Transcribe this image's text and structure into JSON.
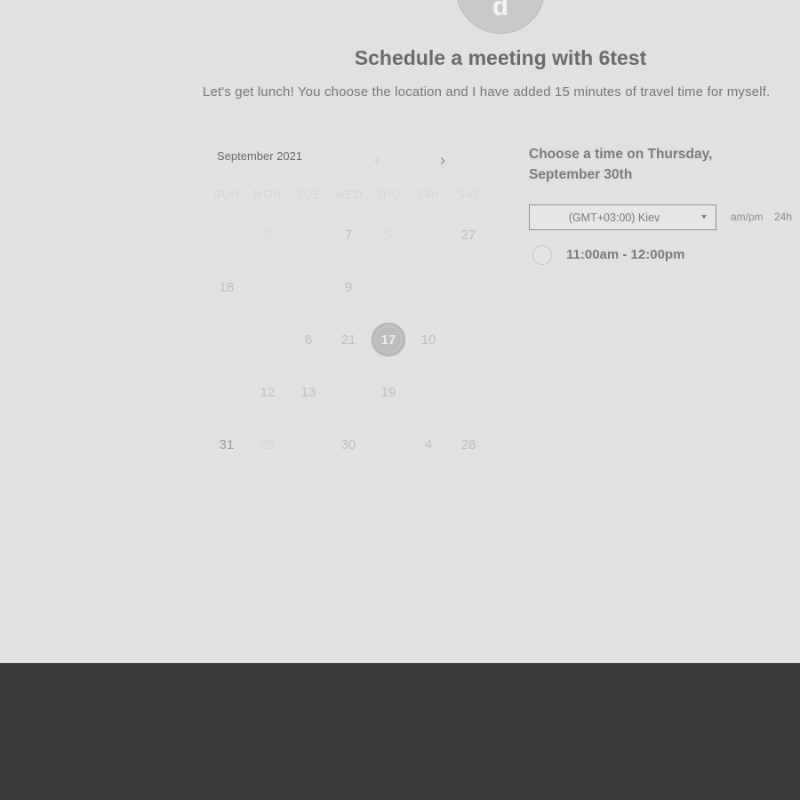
{
  "host": {
    "initial": "d"
  },
  "title": "Schedule a meeting with 6test",
  "description": "Let's get lunch! You choose the location and I have added 15 minutes of travel time for myself.",
  "calendar": {
    "month_label": "September 2021",
    "prev_icon": "‹",
    "next_icon": "›",
    "weekdays": [
      "SUN",
      "MON",
      "TUE",
      "WED",
      "THU",
      "FRI",
      "SAT"
    ],
    "days": [
      {
        "label": "5",
        "col": 1,
        "row": 0,
        "tone": "faint"
      },
      {
        "label": "7",
        "col": 3,
        "row": 0,
        "tone": "light"
      },
      {
        "label": "5",
        "col": 4,
        "row": 0,
        "tone": "faint"
      },
      {
        "label": "27",
        "col": 6,
        "row": 0,
        "tone": "light"
      },
      {
        "label": "18",
        "col": 0,
        "row": 1,
        "tone": "light"
      },
      {
        "label": "9",
        "col": 3,
        "row": 1,
        "tone": "light"
      },
      {
        "label": "6",
        "col": 2,
        "row": 2,
        "tone": "light"
      },
      {
        "label": "21",
        "col": 3,
        "row": 2,
        "tone": "light"
      },
      {
        "label": "17",
        "col": 4,
        "row": 2,
        "tone": "selected"
      },
      {
        "label": "10",
        "col": 5,
        "row": 2,
        "tone": "light"
      },
      {
        "label": "12",
        "col": 1,
        "row": 3,
        "tone": "light"
      },
      {
        "label": "13",
        "col": 2,
        "row": 3,
        "tone": "light"
      },
      {
        "label": "19",
        "col": 4,
        "row": 3,
        "tone": "light"
      },
      {
        "label": "31",
        "col": 0,
        "row": 4,
        "tone": "dark"
      },
      {
        "label": "28",
        "col": 1,
        "row": 4,
        "tone": "faint"
      },
      {
        "label": "30",
        "col": 3,
        "row": 4,
        "tone": "light"
      },
      {
        "label": "4",
        "col": 5,
        "row": 4,
        "tone": "light"
      },
      {
        "label": "28",
        "col": 6,
        "row": 4,
        "tone": "light"
      }
    ]
  },
  "times": {
    "heading": "Choose a time on Thursday, September 30th",
    "timezone": "(GMT+03:00) Kiev",
    "format_ampm": "am/pm",
    "format_24h": "24h",
    "slots": [
      {
        "label": "11:00am - 12:00pm"
      }
    ]
  },
  "colors": {
    "background": "#e1e1e1",
    "footer": "#3a3a3a"
  }
}
